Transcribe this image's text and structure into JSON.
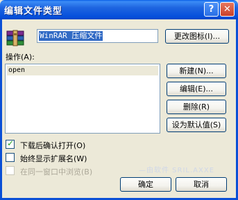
{
  "window": {
    "title": "编辑文件类型",
    "help_glyph": "?",
    "close_glyph": "✕"
  },
  "icon": {
    "name": "winrar-archive-icon"
  },
  "name_field": {
    "value": "WinRAR 压缩文件"
  },
  "buttons": {
    "change_icon": "更改图标(I)...",
    "new": "新建(N)...",
    "edit": "编辑(E)...",
    "delete": "删除(R)",
    "set_default": "设为默认值(S)",
    "ok": "确定",
    "cancel": "取消"
  },
  "actions": {
    "label": "操作(A):",
    "items": [
      "open"
    ]
  },
  "options": [
    {
      "label": "下载后确认打开(O)",
      "checked": true,
      "enabled": true
    },
    {
      "label": "始终显示扩展名(W)",
      "checked": false,
      "enabled": true
    },
    {
      "label": "在同一窗口中浏览(B)",
      "checked": false,
      "enabled": false
    }
  ],
  "watermark": "—由软件 SRIL.AXXE"
}
